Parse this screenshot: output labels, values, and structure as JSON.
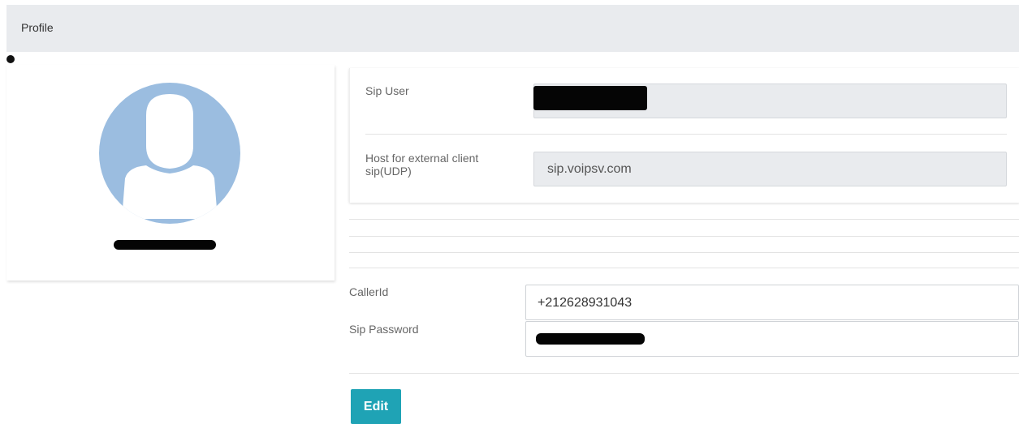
{
  "header": {
    "title": "Profile"
  },
  "profile": {
    "avatar_icon": "user-avatar-icon",
    "username_redacted": true
  },
  "sip": {
    "user_label": "Sip User",
    "user_value_redacted": true,
    "host_label": "Host for external client sip(UDP)",
    "host_value": "sip.voipsv.com"
  },
  "form": {
    "callerid_label": "CallerId",
    "callerid_value": "+212628931043",
    "password_label": "Sip Password",
    "password_value_redacted": true,
    "edit_label": "Edit"
  },
  "colors": {
    "accent": "#1fa3b5",
    "avatar": "#9bbde0",
    "header_bg": "#e9ebee"
  }
}
